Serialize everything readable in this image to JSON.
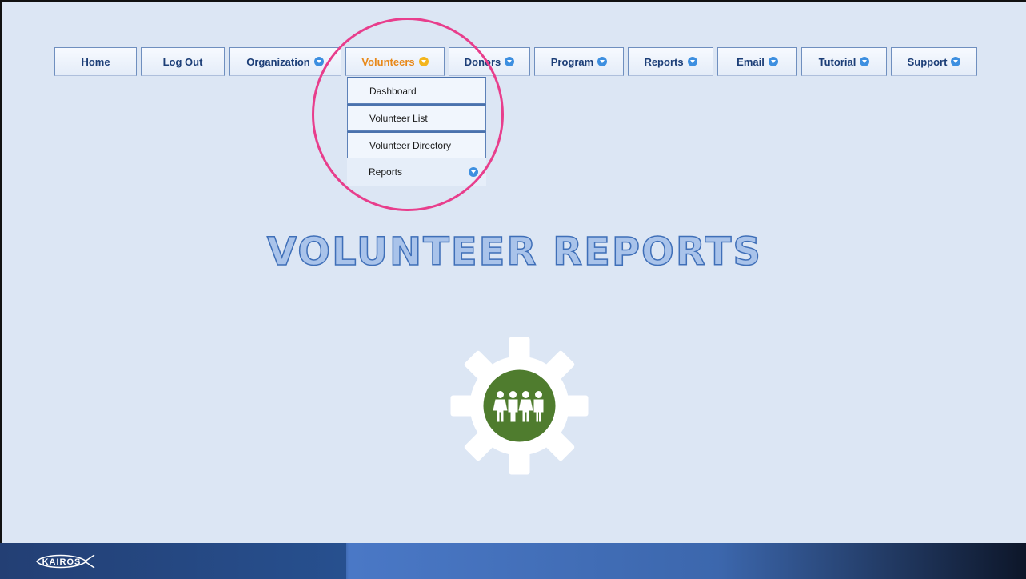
{
  "nav": {
    "items": [
      {
        "label": "Home",
        "caret": false,
        "active": false
      },
      {
        "label": "Log Out",
        "caret": false,
        "active": false
      },
      {
        "label": "Organization",
        "caret": true,
        "active": false
      },
      {
        "label": "Volunteers",
        "caret": true,
        "active": true
      },
      {
        "label": "Donors",
        "caret": true,
        "active": false
      },
      {
        "label": "Program",
        "caret": true,
        "active": false
      },
      {
        "label": "Reports",
        "caret": true,
        "active": false
      },
      {
        "label": "Email",
        "caret": true,
        "active": false
      },
      {
        "label": "Tutorial",
        "caret": true,
        "active": false
      },
      {
        "label": "Support",
        "caret": true,
        "active": false
      }
    ]
  },
  "dropdown": {
    "items": [
      {
        "label": "Dashboard"
      },
      {
        "label": "Volunteer List"
      },
      {
        "label": "Volunteer Directory"
      },
      {
        "label": "Reports",
        "caret": true
      }
    ]
  },
  "title": "VOLUNTEER REPORTS",
  "colors": {
    "background": "#dce6f4",
    "nav_text": "#1c3e77",
    "active_text": "#e8891a",
    "highlight": "#e83e8c",
    "icon_green": "#4f7c2e"
  },
  "icons": {
    "gear": "gear-icon",
    "people": "people-group-icon",
    "logo": "kairos-logo"
  },
  "footer": {
    "logo_text": "KAIROS"
  }
}
